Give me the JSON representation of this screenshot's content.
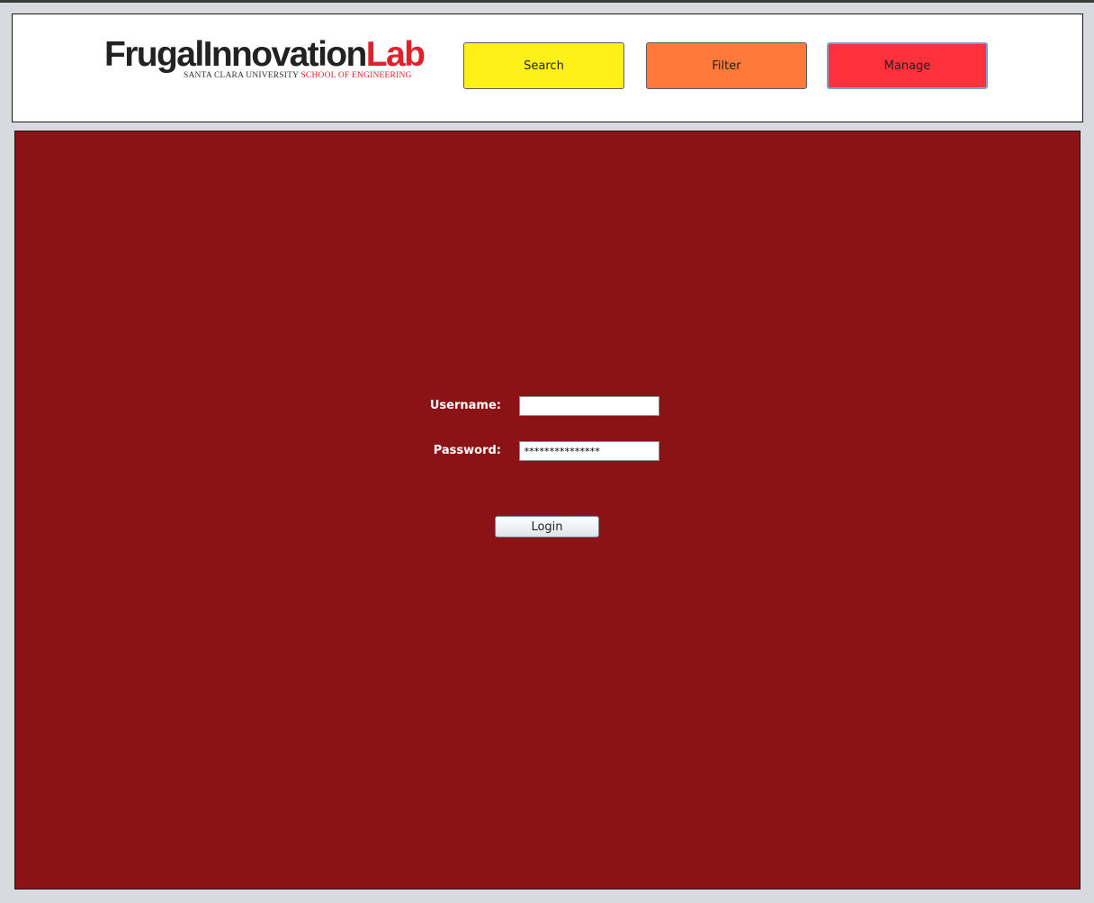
{
  "logo": {
    "brand_dark": "Frugal",
    "brand_dark2": "nnovation",
    "brand_red": "Lab",
    "sub_dark": "SANTA CLARA UNIVERSITY",
    "sub_red": "SCHOOL OF ENGINEERING"
  },
  "nav": {
    "search_label": "Search",
    "filter_label": "Filter",
    "manage_label": "Manage"
  },
  "login_form": {
    "username_label": "Username:",
    "username_value": "",
    "password_label": "Password:",
    "password_value": "***************",
    "login_label": "Login"
  },
  "colors": {
    "search": "#fff017",
    "filter": "#ff7a3a",
    "manage": "#ff323c",
    "panel": "#8c1315"
  }
}
